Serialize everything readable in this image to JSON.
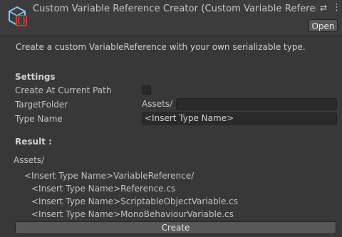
{
  "header": {
    "title": "Custom Variable Reference Creator (Custom Variable Reference",
    "open_label": "Open",
    "icon": "script-braces-icon",
    "icon_accent": "#e8413b",
    "icon_outline": "#8fc7f0"
  },
  "description": "Create a custom VariableReference with your own serializable type.",
  "settings": {
    "title": "Settings",
    "create_at_current_path_label": "Create At Current Path",
    "create_at_current_path_checked": false,
    "target_folder_label": "TargetFolder",
    "target_folder_prefix": "Assets/",
    "target_folder_value": "",
    "type_name_label": "Type Name",
    "type_name_value": "<Insert Type Name>"
  },
  "result": {
    "title": "Result :",
    "root": "Assets/",
    "folder": "<Insert Type Name>VariableReference/",
    "files": [
      "<Insert Type Name>Reference.cs",
      "<Insert Type Name>ScriptableObjectVariable.cs",
      "<Insert Type Name>MonoBehaviourVariable.cs"
    ]
  },
  "create_label": "Create"
}
